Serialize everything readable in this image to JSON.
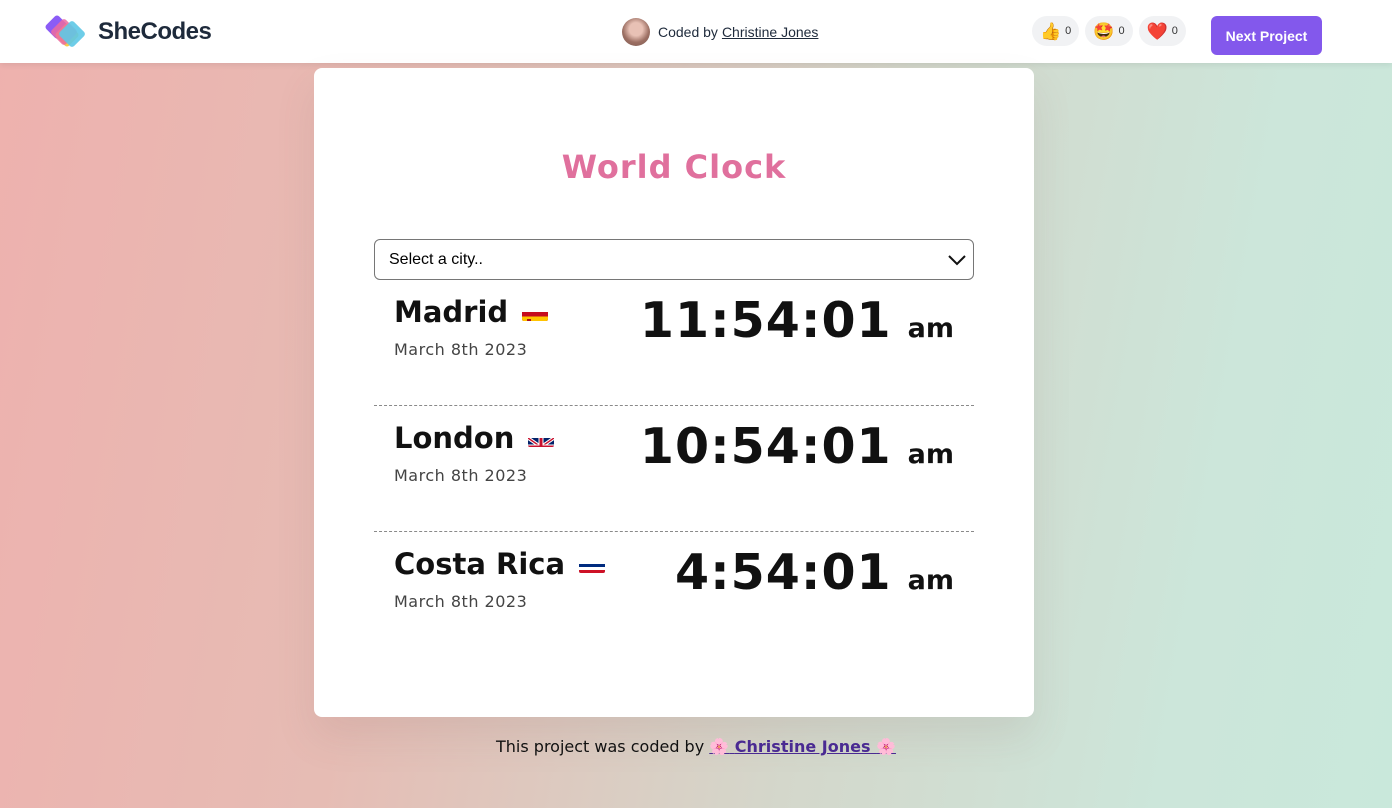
{
  "header": {
    "brand": "SheCodes",
    "coded_by_label": "Coded by",
    "author": "Christine Jones",
    "reactions": [
      {
        "icon": "thumbs-up-icon",
        "emoji": "👍",
        "count": "0"
      },
      {
        "icon": "star-struck-icon",
        "emoji": "🤩",
        "count": "0"
      },
      {
        "icon": "heart-icon",
        "emoji": "❤️",
        "count": "0"
      }
    ],
    "next_button": "Next Project"
  },
  "card": {
    "title": "World Clock",
    "select_placeholder": "Select a city..",
    "cities": [
      {
        "name": "Madrid",
        "flag": "spain-flag",
        "date": "March 8th 2023",
        "time": "11:54:01",
        "ampm": "am"
      },
      {
        "name": "London",
        "flag": "uk-flag",
        "date": "March 8th 2023",
        "time": "10:54:01",
        "ampm": "am"
      },
      {
        "name": "Costa Rica",
        "flag": "costa-rica-flag",
        "date": "March 8th 2023",
        "time": "4:54:01",
        "ampm": "am"
      }
    ]
  },
  "footer": {
    "text": "This project was coded by",
    "flower": "🌸",
    "author": "Christine Jones"
  },
  "colors": {
    "title": "#e0709d",
    "button": "#8358ec",
    "footer_link": "#4a2a92"
  }
}
